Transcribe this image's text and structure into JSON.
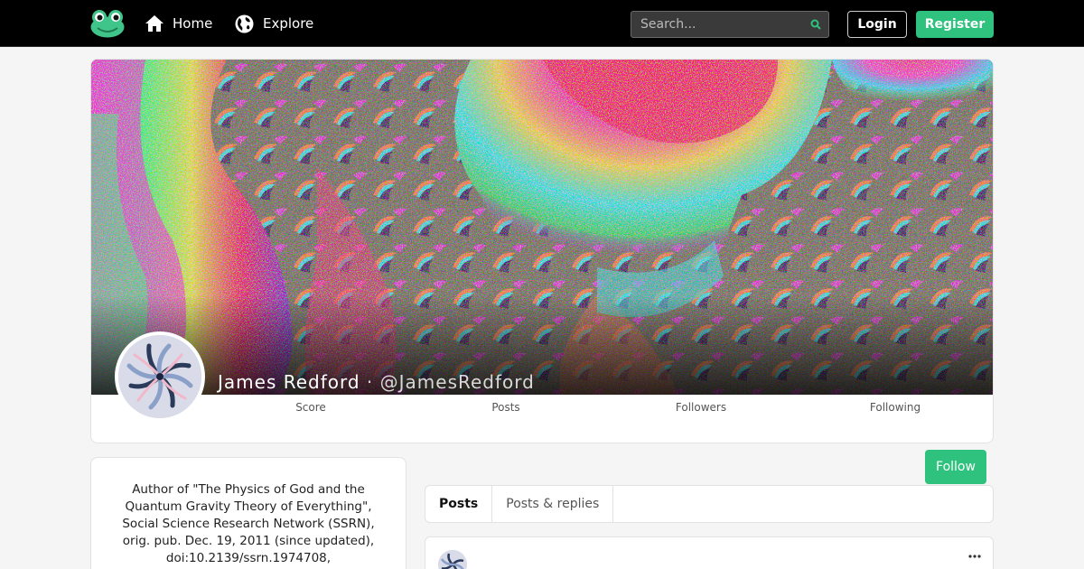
{
  "nav": {
    "home_label": "Home",
    "explore_label": "Explore",
    "search_placeholder": "Search...",
    "login_label": "Login",
    "register_label": "Register",
    "logo_icon": "frog-logo-icon",
    "home_icon": "home-icon",
    "explore_icon": "globe-icon",
    "search_icon": "search-icon"
  },
  "profile": {
    "display_name": "James Redford",
    "separator": " · ",
    "handle": "@JamesRedford",
    "banner_description_icon": "fractal-banner",
    "stats": {
      "score_label": "Score",
      "posts_label": "Posts",
      "followers_label": "Followers",
      "following_label": "Following"
    },
    "follow_label": "Follow",
    "bio": "Author of \"The Physics of God and the Quantum Gravity Theory of Everything\", Social Science Research Network (SSRN), orig. pub. Dec. 19, 2011 (since updated), doi:10.2139/ssrn.1974708,"
  },
  "tabs": [
    {
      "label": "Posts",
      "active": true
    },
    {
      "label": "Posts & replies",
      "active": false
    }
  ],
  "colors": {
    "accent": "#2ec27e",
    "navbar_bg": "#000000",
    "page_bg": "#f5f5f5"
  }
}
